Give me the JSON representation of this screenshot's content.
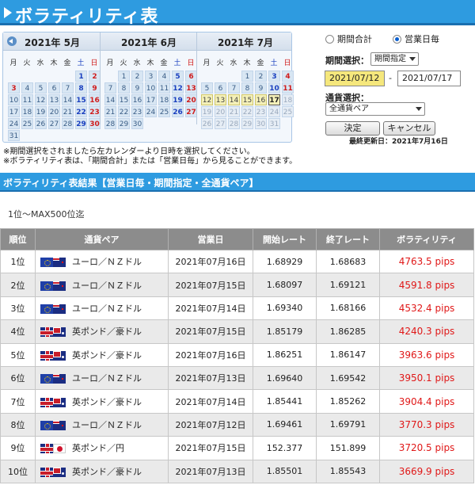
{
  "page": {
    "title": "ボラティリティ表"
  },
  "calendar": {
    "months": [
      {
        "title": "2021年 5月",
        "days": [
          {
            "d": "1",
            "c": "blue"
          },
          {
            "d": "2",
            "c": "red"
          },
          {
            "d": "3",
            "c": "red"
          },
          {
            "d": "4",
            "c": ""
          },
          {
            "d": "5",
            "c": ""
          },
          {
            "d": "6",
            "c": ""
          },
          {
            "d": "7",
            "c": ""
          },
          {
            "d": "8",
            "c": "blue"
          },
          {
            "d": "9",
            "c": "red"
          },
          {
            "d": "10",
            "c": ""
          },
          {
            "d": "11",
            "c": ""
          },
          {
            "d": "12",
            "c": ""
          },
          {
            "d": "13",
            "c": ""
          },
          {
            "d": "14",
            "c": ""
          },
          {
            "d": "15",
            "c": "blue"
          },
          {
            "d": "16",
            "c": "red"
          },
          {
            "d": "17",
            "c": ""
          },
          {
            "d": "18",
            "c": ""
          },
          {
            "d": "19",
            "c": ""
          },
          {
            "d": "20",
            "c": ""
          },
          {
            "d": "21",
            "c": ""
          },
          {
            "d": "22",
            "c": "blue"
          },
          {
            "d": "23",
            "c": "red"
          },
          {
            "d": "24",
            "c": ""
          },
          {
            "d": "25",
            "c": ""
          },
          {
            "d": "26",
            "c": ""
          },
          {
            "d": "27",
            "c": ""
          },
          {
            "d": "28",
            "c": ""
          },
          {
            "d": "29",
            "c": "blue"
          },
          {
            "d": "30",
            "c": "red"
          },
          {
            "d": "31",
            "c": ""
          }
        ],
        "offset": 5
      },
      {
        "title": "2021年 6月",
        "days": [
          {
            "d": "1",
            "c": ""
          },
          {
            "d": "2",
            "c": ""
          },
          {
            "d": "3",
            "c": ""
          },
          {
            "d": "4",
            "c": ""
          },
          {
            "d": "5",
            "c": "blue"
          },
          {
            "d": "6",
            "c": "red"
          },
          {
            "d": "7",
            "c": ""
          },
          {
            "d": "8",
            "c": ""
          },
          {
            "d": "9",
            "c": ""
          },
          {
            "d": "10",
            "c": ""
          },
          {
            "d": "11",
            "c": ""
          },
          {
            "d": "12",
            "c": "blue"
          },
          {
            "d": "13",
            "c": "red"
          },
          {
            "d": "14",
            "c": ""
          },
          {
            "d": "15",
            "c": ""
          },
          {
            "d": "16",
            "c": ""
          },
          {
            "d": "17",
            "c": ""
          },
          {
            "d": "18",
            "c": ""
          },
          {
            "d": "19",
            "c": "blue"
          },
          {
            "d": "20",
            "c": "red"
          },
          {
            "d": "21",
            "c": ""
          },
          {
            "d": "22",
            "c": ""
          },
          {
            "d": "23",
            "c": ""
          },
          {
            "d": "24",
            "c": ""
          },
          {
            "d": "25",
            "c": ""
          },
          {
            "d": "26",
            "c": "blue"
          },
          {
            "d": "27",
            "c": "red"
          },
          {
            "d": "28",
            "c": ""
          },
          {
            "d": "29",
            "c": ""
          },
          {
            "d": "30",
            "c": ""
          }
        ],
        "offset": 1
      },
      {
        "title": "2021年 7月",
        "days": [
          {
            "d": "1",
            "c": ""
          },
          {
            "d": "2",
            "c": ""
          },
          {
            "d": "3",
            "c": "blue"
          },
          {
            "d": "4",
            "c": "red"
          },
          {
            "d": "5",
            "c": ""
          },
          {
            "d": "6",
            "c": ""
          },
          {
            "d": "7",
            "c": ""
          },
          {
            "d": "8",
            "c": ""
          },
          {
            "d": "9",
            "c": ""
          },
          {
            "d": "10",
            "c": "blue"
          },
          {
            "d": "11",
            "c": "red"
          },
          {
            "d": "12",
            "c": "sel"
          },
          {
            "d": "13",
            "c": "sel"
          },
          {
            "d": "14",
            "c": "sel"
          },
          {
            "d": "15",
            "c": "sel"
          },
          {
            "d": "16",
            "c": "sel"
          },
          {
            "d": "17",
            "c": "cur"
          },
          {
            "d": "18",
            "c": "dim"
          },
          {
            "d": "19",
            "c": "dim"
          },
          {
            "d": "20",
            "c": "dim"
          },
          {
            "d": "21",
            "c": "dim"
          },
          {
            "d": "22",
            "c": "dim"
          },
          {
            "d": "23",
            "c": "dim"
          },
          {
            "d": "24",
            "c": "dim"
          },
          {
            "d": "25",
            "c": "dim"
          },
          {
            "d": "26",
            "c": "dim"
          },
          {
            "d": "27",
            "c": "dim"
          },
          {
            "d": "28",
            "c": "dim"
          },
          {
            "d": "29",
            "c": "dim"
          },
          {
            "d": "30",
            "c": "dim"
          },
          {
            "d": "31",
            "c": "dim"
          }
        ],
        "offset": 3
      }
    ],
    "weekdays": [
      "月",
      "火",
      "水",
      "木",
      "金",
      "土",
      "日"
    ]
  },
  "controls": {
    "radio_total": "期間合計",
    "radio_daily": "営業日毎",
    "period_label": "期間選択：",
    "period_select": "期間指定",
    "date_from": "2021/07/12",
    "date_sep": "-",
    "date_to": "2021/07/17",
    "pair_label": "通貨選択：",
    "pair_select": "全通貨ペア",
    "decide_button": "決定",
    "cancel_button": "キャンセル",
    "last_updated": "最終更新日：2021年7月16日"
  },
  "notes": [
    "※期間選択をされましたら左カレンダーより日時を選択してください。",
    "※ボラティリティ表は、「期間合計」または「営業日毎」から見ることができます。"
  ],
  "results": {
    "heading": "ボラティリティ表結果【営業日毎・期間指定・全通貨ペア】",
    "range": "1位〜MAX500位迄",
    "columns": [
      "順位",
      "通貨ペア",
      "営業日",
      "開始レート",
      "終了レート",
      "ボラティリティ"
    ],
    "rows": [
      {
        "rank": "1位",
        "pair": "ユーロ／ＮＺドル",
        "flags": [
          "eu",
          "nz"
        ],
        "date": "2021年07月16日",
        "open": "1.68929",
        "close": "1.68683",
        "vol": "4763.5 pips"
      },
      {
        "rank": "2位",
        "pair": "ユーロ／ＮＺドル",
        "flags": [
          "eu",
          "nz"
        ],
        "date": "2021年07月15日",
        "open": "1.68097",
        "close": "1.69121",
        "vol": "4591.8 pips"
      },
      {
        "rank": "3位",
        "pair": "ユーロ／ＮＺドル",
        "flags": [
          "eu",
          "nz"
        ],
        "date": "2021年07月14日",
        "open": "1.69340",
        "close": "1.68166",
        "vol": "4532.4 pips"
      },
      {
        "rank": "4位",
        "pair": "英ポンド／豪ドル",
        "flags": [
          "gb",
          "au"
        ],
        "date": "2021年07月15日",
        "open": "1.85179",
        "close": "1.86285",
        "vol": "4240.3 pips"
      },
      {
        "rank": "5位",
        "pair": "英ポンド／豪ドル",
        "flags": [
          "gb",
          "au"
        ],
        "date": "2021年07月16日",
        "open": "1.86251",
        "close": "1.86147",
        "vol": "3963.6 pips"
      },
      {
        "rank": "6位",
        "pair": "ユーロ／ＮＺドル",
        "flags": [
          "eu",
          "nz"
        ],
        "date": "2021年07月13日",
        "open": "1.69640",
        "close": "1.69542",
        "vol": "3950.1 pips"
      },
      {
        "rank": "7位",
        "pair": "英ポンド／豪ドル",
        "flags": [
          "gb",
          "au"
        ],
        "date": "2021年07月14日",
        "open": "1.85441",
        "close": "1.85262",
        "vol": "3904.4 pips"
      },
      {
        "rank": "8位",
        "pair": "ユーロ／ＮＺドル",
        "flags": [
          "eu",
          "nz"
        ],
        "date": "2021年07月12日",
        "open": "1.69461",
        "close": "1.69791",
        "vol": "3770.3 pips"
      },
      {
        "rank": "9位",
        "pair": "英ポンド／円",
        "flags": [
          "gb",
          "jp"
        ],
        "date": "2021年07月15日",
        "open": "152.377",
        "close": "151.899",
        "vol": "3720.5 pips"
      },
      {
        "rank": "10位",
        "pair": "英ポンド／豪ドル",
        "flags": [
          "gb",
          "au"
        ],
        "date": "2021年07月13日",
        "open": "1.85501",
        "close": "1.85543",
        "vol": "3669.9 pips"
      }
    ]
  }
}
